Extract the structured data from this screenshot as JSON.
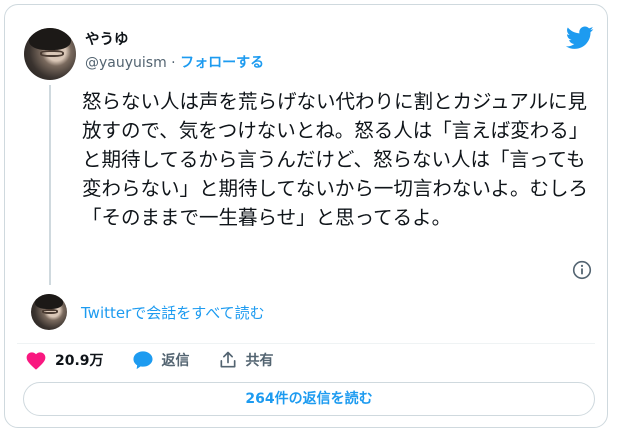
{
  "user": {
    "display_name": "やうゆ",
    "handle": "@yauyuism",
    "separator": "·",
    "follow_label": "フォローする"
  },
  "tweet": {
    "text": "怒らない人は声を荒らげない代わりに割とカジュアルに見放すので、気をつけないとね。怒る人は「言えば変わる」と期待してるから言うんだけど、怒らない人は「言っても変わらない」と期待してないから一切言わないよ。むしろ「そのままで一生暮らせ」と思ってるよ。"
  },
  "conversation": {
    "read_all_label": "Twitterで会話をすべて読む"
  },
  "actions": {
    "like_count": "20.9万",
    "reply_label": "返信",
    "share_label": "共有"
  },
  "replies_button": {
    "label": "264件の返信を読む"
  },
  "colors": {
    "accent": "#1d9bf0",
    "like": "#f91880",
    "text": "#0f1419",
    "secondary": "#536471",
    "border": "#cfd9de"
  },
  "icons": [
    "twitter-bird-icon",
    "info-icon",
    "heart-icon",
    "reply-bubble-icon",
    "share-icon"
  ]
}
